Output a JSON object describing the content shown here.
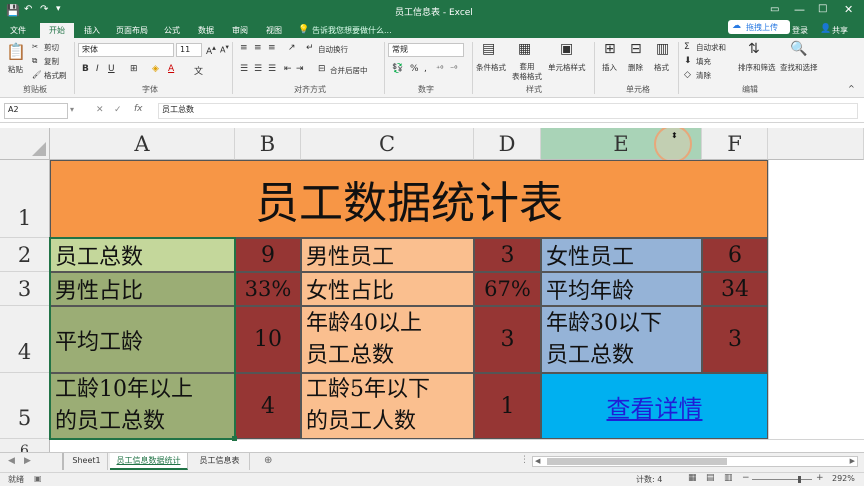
{
  "window": {
    "title": "员工信息表 - Excel",
    "search_hint": "告诉我您想要做什么...",
    "share": "共享",
    "login": "登录",
    "upload": "拖拽上传"
  },
  "menu": [
    "文件",
    "开始",
    "插入",
    "页面布局",
    "公式",
    "数据",
    "审阅",
    "视图"
  ],
  "ribbon": {
    "clipboard": {
      "paste": "粘贴",
      "cut": "剪切",
      "copy": "复制",
      "format_painter": "格式刷",
      "label": "剪贴板"
    },
    "font": {
      "name": "宋体",
      "size": "11",
      "label": "字体"
    },
    "alignment": {
      "wrap": "自动换行",
      "merge": "合并后居中",
      "label": "对齐方式"
    },
    "number": {
      "format": "常规",
      "label": "数字"
    },
    "styles": {
      "conditional": "条件格式",
      "table": "套用\n表格格式",
      "cell": "单元格样式",
      "label": "样式"
    },
    "cells": {
      "insert": "插入",
      "delete": "删除",
      "format": "格式",
      "label": "单元格"
    },
    "editing": {
      "autosum": "自动求和",
      "fill": "填充",
      "clear": "清除",
      "sort": "排序和筛选",
      "find": "查找和选择",
      "label": "编辑"
    }
  },
  "formula_bar": {
    "name_box": "A2",
    "fx": "fx",
    "content": "员工总数"
  },
  "columns": [
    "A",
    "B",
    "C",
    "D",
    "E",
    "F"
  ],
  "rows": [
    "1",
    "2",
    "3",
    "4",
    "5",
    "6"
  ],
  "sheet": {
    "title": "员工数据统计表",
    "r2": {
      "a": "员工总数",
      "b": "9",
      "c": "男性员工",
      "d": "3",
      "e": "女性员工",
      "f": "6"
    },
    "r3": {
      "a": "男性占比",
      "b": "33%",
      "c": "女性占比",
      "d": "67%",
      "e": "平均年龄",
      "f": "34"
    },
    "r4": {
      "a": "平均工龄",
      "b": "10",
      "c": "年龄40以上\n员工总数",
      "d": "3",
      "e": "年龄30以下\n员工总数",
      "f": "3"
    },
    "r5": {
      "a": "工龄10年以上\n的员工总数",
      "b": "4",
      "c": "工龄5年以下\n的员工人数",
      "d": "1",
      "e_link": "查看详情"
    }
  },
  "sheet_tabs": [
    "Sheet1",
    "员工信息数据统计",
    "员工信息表"
  ],
  "status": {
    "ready": "就绪",
    "count": "计数: 4",
    "zoom": "292%"
  },
  "colors": {
    "orange": "#f79646",
    "green_light": "#c4d79b",
    "green": "#9bad75",
    "red": "#963634",
    "peach": "#fabf8f",
    "blue": "#95b3d7",
    "cyan": "#00b0f0",
    "excel": "#217346"
  }
}
